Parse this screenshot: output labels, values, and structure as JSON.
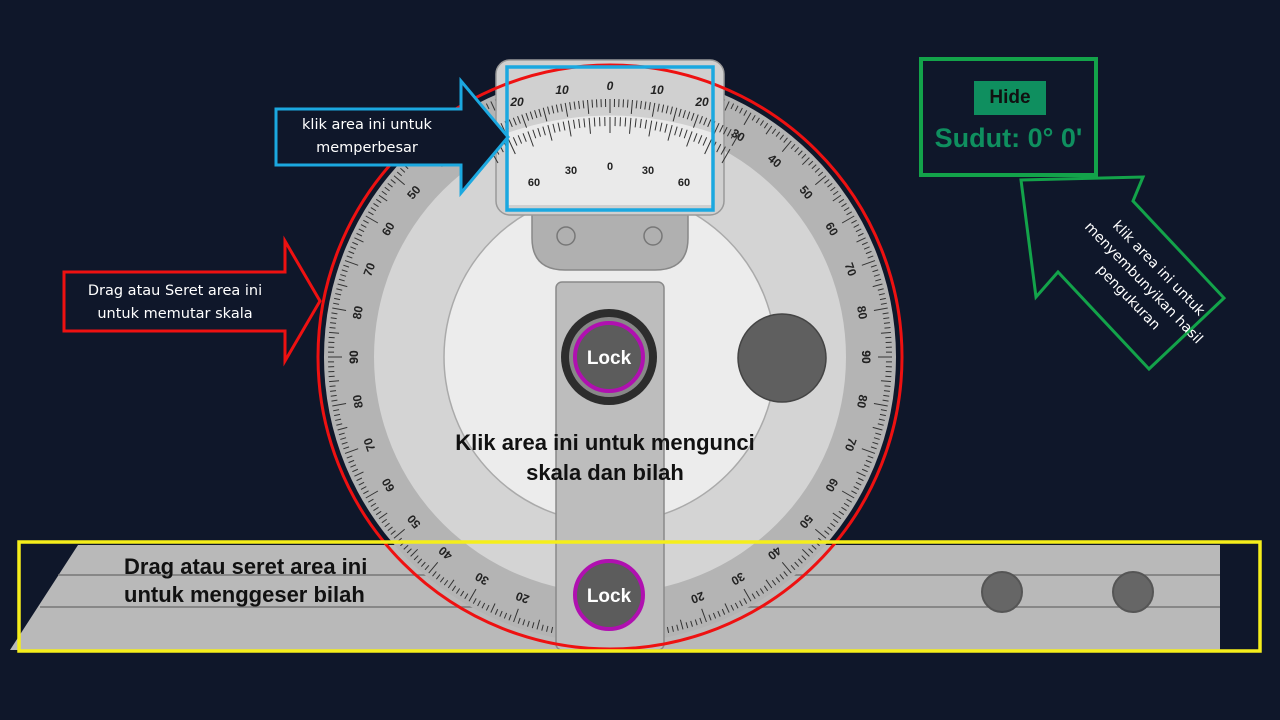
{
  "colors": {
    "background": "#0f172a",
    "accent_green": "#0f8f5f",
    "zoom_hint_border": "#1ba8e0",
    "rotate_hint_border": "#ee1111",
    "slide_hint_border": "#f5ee1b",
    "lock_ring": "#b010b0"
  },
  "result_panel": {
    "hide_label": "Hide",
    "angle_text": "Sudut: 0° 0'"
  },
  "vernier": {
    "top_numbers": [
      "20",
      "10",
      "0",
      "10",
      "20"
    ],
    "bottom_numbers": [
      "60",
      "30",
      "0",
      "30",
      "60"
    ]
  },
  "protractor": {
    "labels": [
      "90",
      "80",
      "70",
      "60",
      "50",
      "40",
      "30",
      "20",
      "10",
      "0",
      "10",
      "20",
      "30",
      "40",
      "50",
      "60",
      "70",
      "80",
      "90"
    ]
  },
  "locks": {
    "dial_lock_label": "Lock",
    "blade_lock_label": "Lock"
  },
  "hints": {
    "zoom": "klik area ini untuk memperbesar",
    "rotate": "Drag atau Seret area ini untuk memutar skala",
    "lock": "Klik area ini untuk mengunci skala dan bilah",
    "slide": "Drag atau seret area ini untuk menggeser bilah",
    "hide": "klik area ini untuk menyembunyikan hasil pengukuran"
  }
}
